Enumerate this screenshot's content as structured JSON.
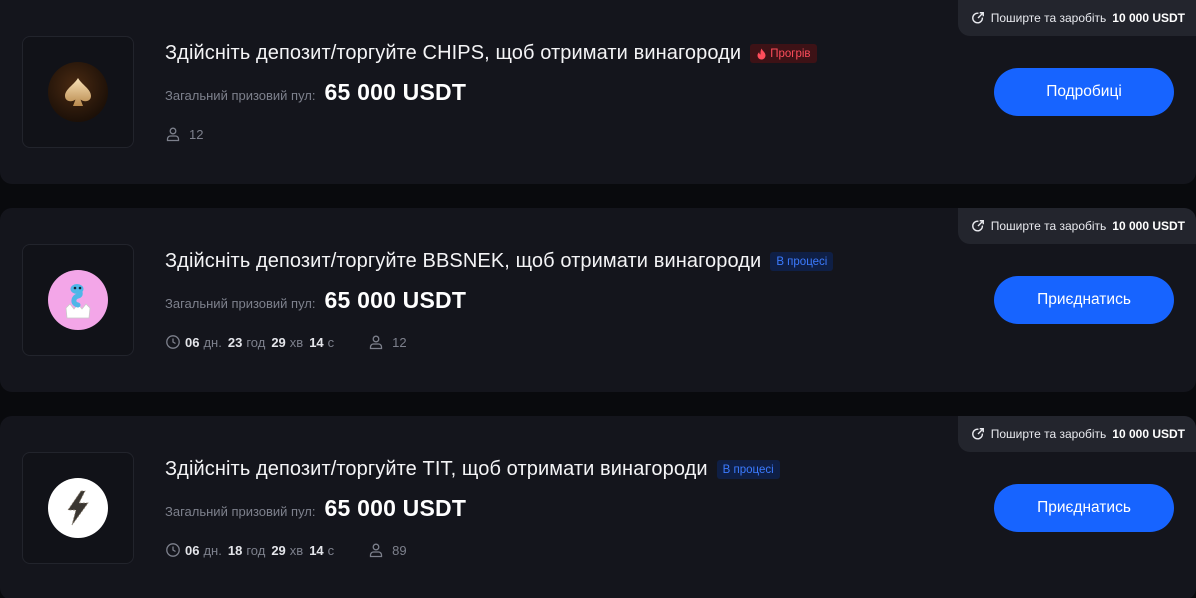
{
  "campaigns": [
    {
      "share_text": "Поширте та заробіть",
      "share_amount": "10 000 USDT",
      "logo": "chips-spade-logo",
      "title": "Здійсніть депозит/торгуйте CHIPS, щоб отримати винагороди",
      "badge": "Прогрів",
      "badge_icon": "fire-icon",
      "pool_label": "Загальний призовий пул:",
      "pool_value": "65 000 USDT",
      "participants": "12",
      "button": "Подробиці"
    },
    {
      "share_text": "Поширте та заробіть",
      "share_amount": "10 000 USDT",
      "logo": "bbsnek-snake-logo",
      "title": "Здійсніть депозит/торгуйте BBSNEK, щоб отримати винагороди",
      "badge": "В процесі",
      "pool_label": "Загальний призовий пул:",
      "pool_value": "65 000 USDT",
      "timer": {
        "days": "06",
        "days_unit": "дн.",
        "hours": "23",
        "hours_unit": "год",
        "minutes": "29",
        "minutes_unit": "хв",
        "seconds": "14",
        "seconds_unit": "с"
      },
      "participants": "12",
      "button": "Приєднатись"
    },
    {
      "share_text": "Поширте та заробіть",
      "share_amount": "10 000 USDT",
      "logo": "tit-lightning-logo",
      "title": "Здійсніть депозит/торгуйте TIT, щоб отримати винагороди",
      "badge": "В процесі",
      "pool_label": "Загальний призовий пул:",
      "pool_value": "65 000 USDT",
      "timer": {
        "days": "06",
        "days_unit": "дн.",
        "hours": "18",
        "hours_unit": "год",
        "minutes": "29",
        "minutes_unit": "хв",
        "seconds": "14",
        "seconds_unit": "с"
      },
      "participants": "89",
      "button": "Приєднатись"
    }
  ],
  "colors": {
    "accent": "#1764ff",
    "hot": "#ff4d5b",
    "progress": "#3c7bff",
    "card": "#14151c"
  }
}
